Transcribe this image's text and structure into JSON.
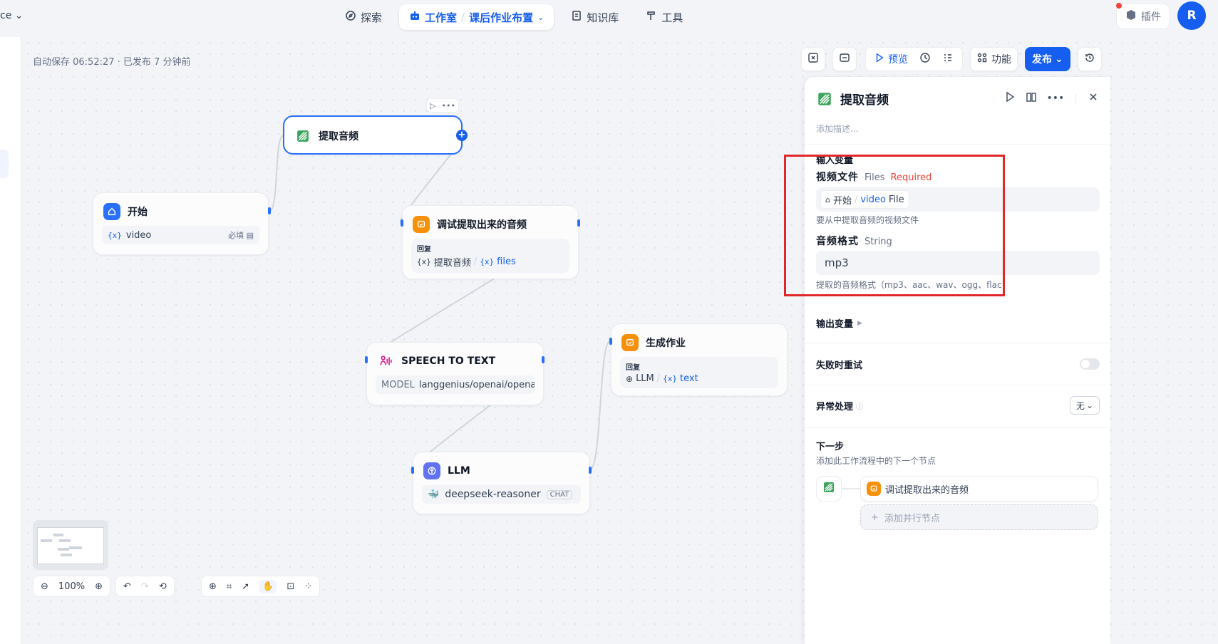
{
  "workspace": {
    "label": "ce"
  },
  "nav": {
    "explore": "探索",
    "studio": "工作室",
    "app_name": "课后作业布置",
    "knowledge": "知识库",
    "tools": "工具"
  },
  "header": {
    "plugins": "插件",
    "avatar_initial": "R"
  },
  "canvas": {
    "autosave": "自动保存 06:52:27 · 已发布 7 分钟前"
  },
  "toolbar": {
    "preview": "预览",
    "features": "功能",
    "publish": "发布"
  },
  "nodes": {
    "extract": {
      "title": "提取音频"
    },
    "start": {
      "title": "开始",
      "var": "video",
      "required": "必填"
    },
    "debug": {
      "title": "调试提取出来的音频",
      "reply_label": "回复",
      "src_node": "提取音频",
      "src_var": "files"
    },
    "stt": {
      "title": "SPEECH TO TEXT",
      "model_label": "MODEL",
      "model_value": "langgenius/openai/opena..."
    },
    "homework": {
      "title": "生成作业",
      "reply_label": "回复",
      "src_node": "LLM",
      "src_var": "text"
    },
    "llm": {
      "title": "LLM",
      "model": "deepseek-reasoner",
      "mode": "CHAT"
    }
  },
  "bottom": {
    "zoom": "100%"
  },
  "panel": {
    "title": "提取音频",
    "desc_placeholder": "添加描述...",
    "input_section": "输入变量",
    "field1": {
      "label": "视频文件",
      "type": "Files",
      "required": "Required",
      "src_node": "开始",
      "src_var": "video",
      "src_type": "File",
      "hint": "要从中提取音频的视频文件"
    },
    "field2": {
      "label": "音频格式",
      "type": "String",
      "value": "mp3",
      "hint": "提取的音频格式（mp3、aac、wav、ogg、flac"
    },
    "output_section": "输出变量",
    "retry": "失败时重试",
    "error_handling": "异常处理",
    "error_value": "无",
    "next_title": "下一步",
    "next_desc": "添加此工作流程中的下一个节点",
    "next_node": "调试提取出来的音频",
    "add_parallel": "添加并行节点"
  }
}
